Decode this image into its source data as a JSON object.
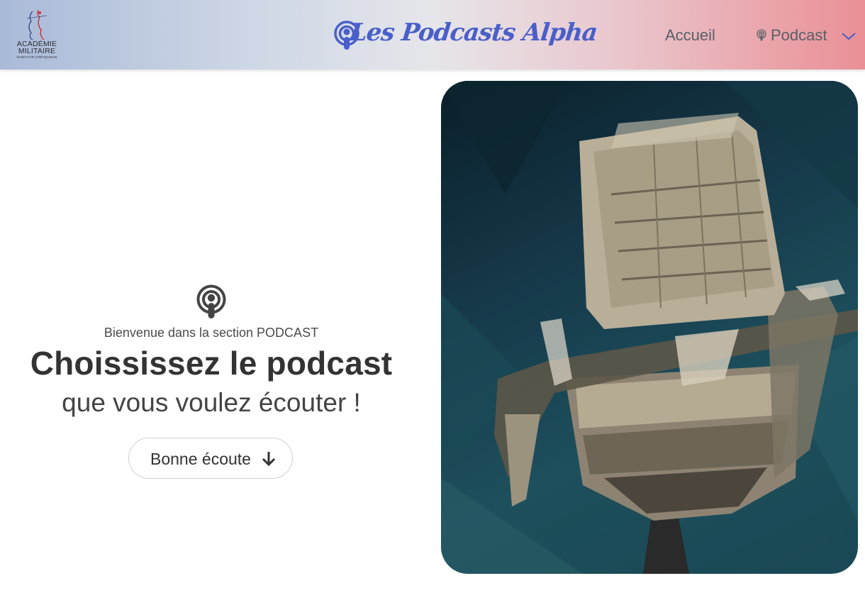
{
  "header": {
    "logo": {
      "line1": "ACADÉMIE",
      "line2": "MILITAIRE",
      "line3": "SAINT-CYR COËTQUIDAN",
      "icon": "academie-emblem"
    },
    "brand": {
      "text": "Les Podcasts Alpha",
      "icon": "podcast-icon",
      "color": "#4a5fc9"
    },
    "nav": {
      "accueil": "Accueil",
      "podcast": "Podcast",
      "podcast_icon": "podcast-icon",
      "dropdown_icon": "chevron-down-icon"
    },
    "gradient": [
      "#a9bad8",
      "#e6e6ea",
      "#ea8f96"
    ]
  },
  "hero": {
    "icon": "podcast-icon",
    "welcome": "Bienvenue dans la section PODCAST",
    "title": "Choississez le podcast",
    "subtitle": "que vous voulez écouter !",
    "button": {
      "label": "Bonne écoute",
      "icon": "arrow-down-icon"
    }
  },
  "image": {
    "subject": "microphone-illustration"
  }
}
